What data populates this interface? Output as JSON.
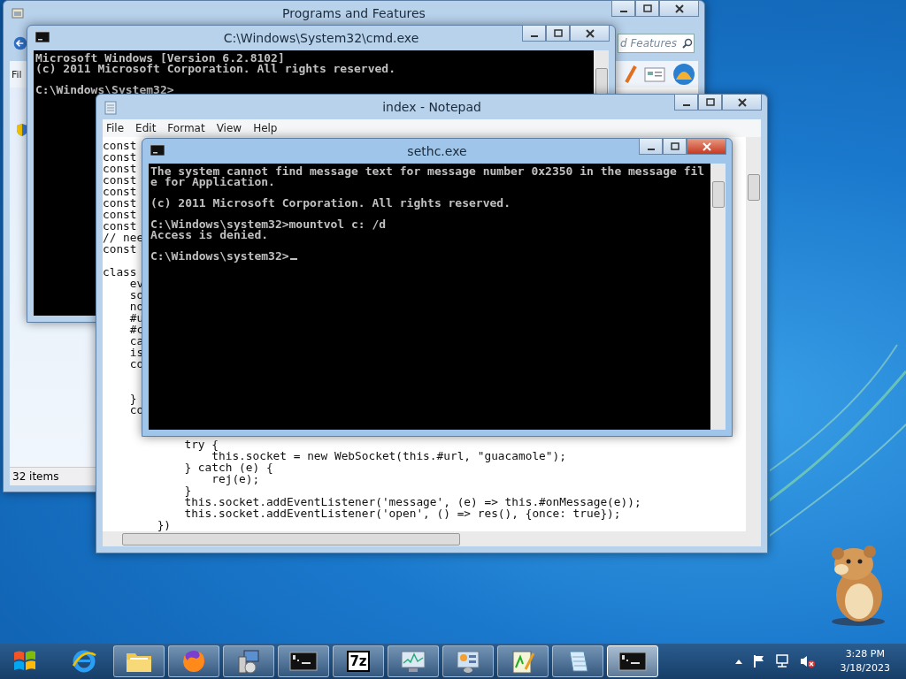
{
  "programs_window": {
    "title": "Programs and Features",
    "active": false,
    "menu": [
      "Fil"
    ],
    "search": {
      "placeholder": "d Features"
    },
    "status": "32 items"
  },
  "cmd_window": {
    "title": "C:\\Windows\\System32\\cmd.exe",
    "active": false,
    "output": "Microsoft Windows [Version 6.2.8102]\n(c) 2011 Microsoft Corporation. All rights reserved.\n\nC:\\Windows\\System32>"
  },
  "notepad_window": {
    "title": "index - Notepad",
    "active": false,
    "menu": [
      "File",
      "Edit",
      "Format",
      "View",
      "Help"
    ],
    "text_top": "const\nconst\nconst\nconst\nconst\nconst\nconst\nconst\n// nee\nconst\n\nclass\n    ev\n    so\n    no\n    #u\n    #c\n    ca\n    is\n    co\n\n\n    }\n    co",
    "text_bottom": "            try {\n                this.socket = new WebSocket(this.#url, \"guacamole\");\n            } catch (e) {\n                rej(e);\n            }\n            this.socket.addEventListener('message', (e) => this.#onMessage(e));\n            this.socket.addEventListener('open', () => res(), {once: true});\n        })"
  },
  "sethc_window": {
    "title": "sethc.exe",
    "active": true,
    "output": "The system cannot find message text for message number 0x2350 in the message fil\ne for Application.\n\n(c) 2011 Microsoft Corporation. All rights reserved.\n\nC:\\Windows\\system32>mountvol c: /d\nAccess is denied.\n\nC:\\Windows\\system32>"
  },
  "taskbar": {
    "items": [
      {
        "kind": "browser",
        "running": false,
        "selected": false
      },
      {
        "kind": "folder",
        "running": true,
        "selected": false
      },
      {
        "kind": "firefox",
        "running": true,
        "selected": false
      },
      {
        "kind": "setup",
        "running": true,
        "selected": false
      },
      {
        "kind": "console",
        "running": true,
        "selected": false
      },
      {
        "kind": "archive",
        "label": "7z",
        "running": true,
        "selected": false
      },
      {
        "kind": "monitor",
        "running": true,
        "selected": false
      },
      {
        "kind": "panel",
        "running": true,
        "selected": false
      },
      {
        "kind": "editor",
        "running": true,
        "selected": false
      },
      {
        "kind": "notepad",
        "running": true,
        "selected": false
      },
      {
        "kind": "console",
        "running": true,
        "selected": true
      }
    ],
    "clock": {
      "time": "3:28 PM",
      "date": "3/18/2023"
    }
  }
}
